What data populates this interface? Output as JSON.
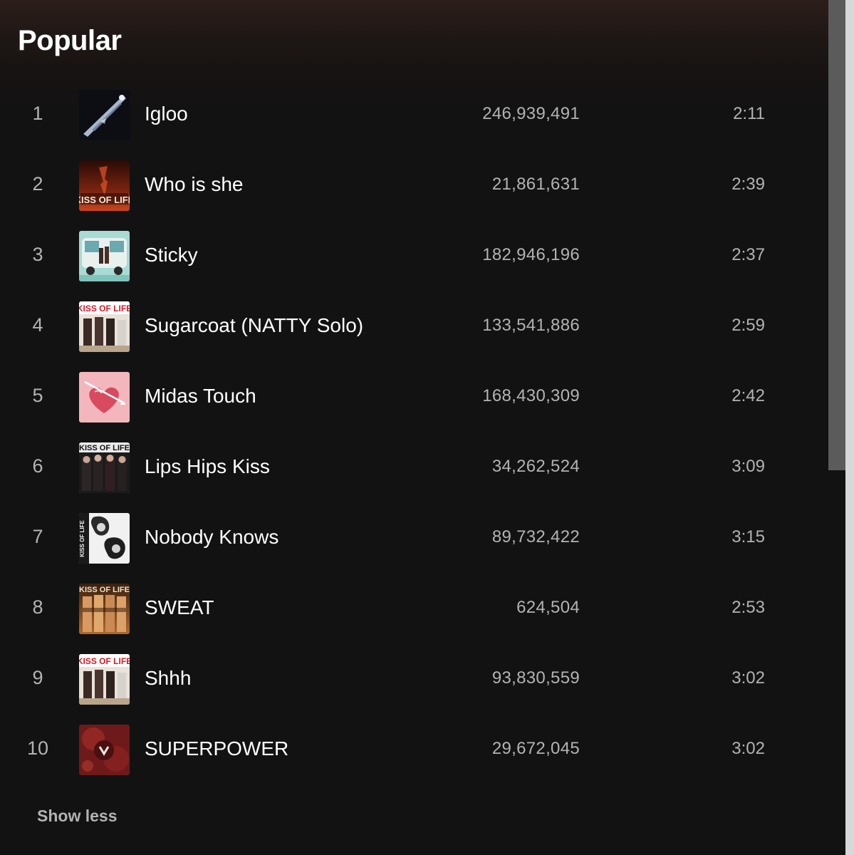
{
  "section": {
    "title": "Popular"
  },
  "tracks": [
    {
      "num": "1",
      "title": "Igloo",
      "plays": "246,939,491",
      "duration": "2:11",
      "cover_color": "#0d0f14"
    },
    {
      "num": "2",
      "title": "Who is she",
      "plays": "21,861,631",
      "duration": "2:39",
      "cover_color": "#5a1a10"
    },
    {
      "num": "3",
      "title": "Sticky",
      "plays": "182,946,196",
      "duration": "2:37",
      "cover_color": "#9fd3cf"
    },
    {
      "num": "4",
      "title": "Sugarcoat (NATTY Solo)",
      "plays": "133,541,886",
      "duration": "2:59",
      "cover_color": "#e6dfd6"
    },
    {
      "num": "5",
      "title": "Midas Touch",
      "plays": "168,430,309",
      "duration": "2:42",
      "cover_color": "#f2a3ad"
    },
    {
      "num": "6",
      "title": "Lips Hips Kiss",
      "plays": "34,262,524",
      "duration": "3:09",
      "cover_color": "#1a1a1a"
    },
    {
      "num": "7",
      "title": "Nobody Knows",
      "plays": "89,732,422",
      "duration": "3:15",
      "cover_color": "#e8e8e8"
    },
    {
      "num": "8",
      "title": "SWEAT",
      "plays": "624,504",
      "duration": "2:53",
      "cover_color": "#8a4a1c"
    },
    {
      "num": "9",
      "title": "Shhh",
      "plays": "93,830,559",
      "duration": "3:02",
      "cover_color": "#e6dfd6"
    },
    {
      "num": "10",
      "title": "SUPERPOWER",
      "plays": "29,672,045",
      "duration": "3:02",
      "cover_color": "#7a1e1e"
    }
  ],
  "footer": {
    "show_less_label": "Show less"
  },
  "logo_text": {
    "kiss_of_life": "KISS OF LIFE"
  }
}
